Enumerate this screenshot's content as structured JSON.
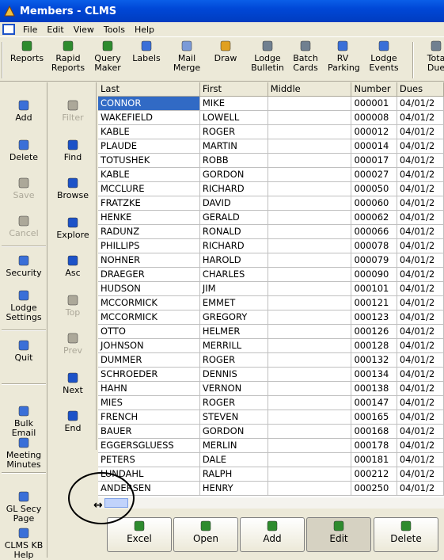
{
  "window": {
    "title": "Members - CLMS"
  },
  "menu": [
    "File",
    "Edit",
    "View",
    "Tools",
    "Help"
  ],
  "toolbar": [
    {
      "label": "Reports",
      "icon": "reports-icon",
      "color": "#2e8b2e"
    },
    {
      "label": "Rapid\nReports",
      "icon": "rapid-reports-icon",
      "color": "#2e8b2e"
    },
    {
      "label": "Query\nMaker",
      "icon": "query-maker-icon",
      "color": "#2e8b2e"
    },
    {
      "label": "Labels",
      "icon": "labels-icon",
      "color": "#3a6fd8"
    },
    {
      "label": "Mail\nMerge",
      "icon": "mail-merge-icon",
      "color": "#7a9ad8"
    },
    {
      "label": "Draw",
      "icon": "draw-icon",
      "color": "#e0a020"
    },
    {
      "label": "Lodge\nBulletin",
      "icon": "lodge-bulletin-icon",
      "color": "#708090"
    },
    {
      "label": "Batch\nCards",
      "icon": "batch-cards-icon",
      "color": "#708090"
    },
    {
      "label": "RV\nParking",
      "icon": "rv-parking-icon",
      "color": "#3a6fd8"
    },
    {
      "label": "Lodge\nEvents",
      "icon": "lodge-events-icon",
      "color": "#3a6fd8"
    },
    {
      "label": "Tota\nDue",
      "icon": "total-dues-icon",
      "color": "#708090"
    }
  ],
  "left_actions": [
    {
      "label": "Add",
      "icon": "add-icon",
      "enabled": true
    },
    {
      "label": "Delete",
      "icon": "delete-icon",
      "enabled": true
    },
    {
      "label": "Save",
      "icon": "save-icon",
      "enabled": false
    },
    {
      "label": "Cancel",
      "icon": "cancel-icon",
      "enabled": false
    },
    {
      "label": "Security",
      "icon": "lock-icon",
      "enabled": true
    },
    {
      "label": "Lodge\nSettings",
      "icon": "settings-icon",
      "enabled": true
    },
    {
      "label": "Quit",
      "icon": "quit-icon",
      "enabled": true
    },
    {
      "label": "Bulk\nEmail",
      "icon": "bulk-email-icon",
      "enabled": true
    },
    {
      "label": "Meeting\nMinutes",
      "icon": "meeting-minutes-icon",
      "enabled": true
    },
    {
      "label": "GL Secy\nPage",
      "icon": "globe-icon",
      "enabled": true
    },
    {
      "label": "CLMS KB\nHelp",
      "icon": "help-globe-icon",
      "enabled": true
    }
  ],
  "nav_actions": [
    {
      "label": "Filter",
      "icon": "filter-icon",
      "enabled": false
    },
    {
      "label": "Find",
      "icon": "binoculars-icon",
      "enabled": true
    },
    {
      "label": "Browse",
      "icon": "browse-icon",
      "enabled": true
    },
    {
      "label": "Explore",
      "icon": "explore-icon",
      "enabled": true
    },
    {
      "label": "Asc",
      "icon": "sort-asc-icon",
      "enabled": true
    },
    {
      "label": "Top",
      "icon": "first-record-icon",
      "enabled": false
    },
    {
      "label": "Prev",
      "icon": "prev-record-icon",
      "enabled": false
    },
    {
      "label": "Next",
      "icon": "next-record-icon",
      "enabled": true
    },
    {
      "label": "End",
      "icon": "last-record-icon",
      "enabled": true
    }
  ],
  "grid": {
    "columns": [
      "Last",
      "First",
      "Middle",
      "Number",
      "Dues"
    ],
    "rows": [
      [
        "CONNOR",
        "MIKE",
        "",
        "000001",
        "04/01/2"
      ],
      [
        "WAKEFIELD",
        "LOWELL",
        "",
        "000008",
        "04/01/2"
      ],
      [
        "KABLE",
        "ROGER",
        "",
        "000012",
        "04/01/2"
      ],
      [
        "PLAUDE",
        "MARTIN",
        "",
        "000014",
        "04/01/2"
      ],
      [
        "TOTUSHEK",
        "ROBB",
        "",
        "000017",
        "04/01/2"
      ],
      [
        "KABLE",
        "GORDON",
        "",
        "000027",
        "04/01/2"
      ],
      [
        "MCCLURE",
        "RICHARD",
        "",
        "000050",
        "04/01/2"
      ],
      [
        "FRATZKE",
        "DAVID",
        "",
        "000060",
        "04/01/2"
      ],
      [
        "HENKE",
        "GERALD",
        "",
        "000062",
        "04/01/2"
      ],
      [
        "RADUNZ",
        "RONALD",
        "",
        "000066",
        "04/01/2"
      ],
      [
        "PHILLIPS",
        "RICHARD",
        "",
        "000078",
        "04/01/2"
      ],
      [
        "NOHNER",
        "HAROLD",
        "",
        "000079",
        "04/01/2"
      ],
      [
        "DRAEGER",
        "CHARLES",
        "",
        "000090",
        "04/01/2"
      ],
      [
        "HUDSON",
        "JIM",
        "",
        "000101",
        "04/01/2"
      ],
      [
        "MCCORMICK",
        "EMMET",
        "",
        "000121",
        "04/01/2"
      ],
      [
        "MCCORMICK",
        "GREGORY",
        "",
        "000123",
        "04/01/2"
      ],
      [
        "OTTO",
        "HELMER",
        "",
        "000126",
        "04/01/2"
      ],
      [
        "JOHNSON",
        "MERRILL",
        "",
        "000128",
        "04/01/2"
      ],
      [
        "DUMMER",
        "ROGER",
        "",
        "000132",
        "04/01/2"
      ],
      [
        "SCHROEDER",
        "DENNIS",
        "",
        "000134",
        "04/01/2"
      ],
      [
        "HAHN",
        "VERNON",
        "",
        "000138",
        "04/01/2"
      ],
      [
        "MIES",
        "ROGER",
        "",
        "000147",
        "04/01/2"
      ],
      [
        "FRENCH",
        "STEVEN",
        "",
        "000165",
        "04/01/2"
      ],
      [
        "BAUER",
        "GORDON",
        "",
        "000168",
        "04/01/2"
      ],
      [
        "EGGERSGLUESS",
        "MERLIN",
        "",
        "000178",
        "04/01/2"
      ],
      [
        "PETERS",
        "DALE",
        "",
        "000181",
        "04/01/2"
      ],
      [
        "LUNDAHL",
        "RALPH",
        "",
        "000212",
        "04/01/2"
      ],
      [
        "ANDERSEN",
        "HENRY",
        "",
        "000250",
        "04/01/2"
      ]
    ]
  },
  "bottom_buttons": [
    {
      "label": "Excel",
      "icon": "excel-icon"
    },
    {
      "label": "Open",
      "icon": "open-folder-icon"
    },
    {
      "label": "Add",
      "icon": "add-icon"
    },
    {
      "label": "Edit",
      "icon": "edit-icon"
    },
    {
      "label": "Delete",
      "icon": "delete-icon"
    }
  ]
}
